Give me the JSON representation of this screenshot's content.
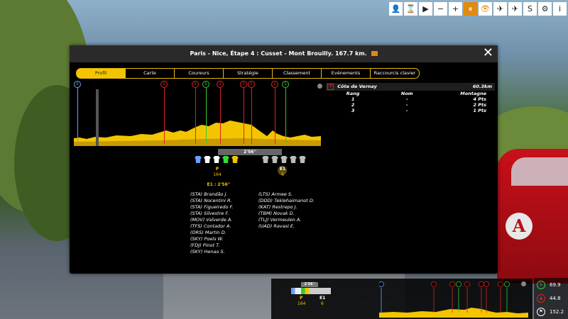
{
  "toolbar": {
    "buttons": [
      {
        "icon": "person-icon",
        "glyph": "👤"
      },
      {
        "icon": "hourglass-icon",
        "glyph": "⌛"
      },
      {
        "icon": "play-icon",
        "glyph": "▶"
      },
      {
        "icon": "minus-icon",
        "glyph": "−"
      },
      {
        "icon": "plus-icon",
        "glyph": "+"
      },
      {
        "icon": "pause-icon",
        "glyph": "⏸"
      },
      {
        "icon": "eye-icon",
        "glyph": "👁"
      },
      {
        "icon": "motorbike-icon",
        "glyph": "✈"
      },
      {
        "icon": "helicopter-icon",
        "glyph": "✈"
      },
      {
        "icon": "sprint-icon",
        "glyph": "S"
      },
      {
        "icon": "settings-icon",
        "glyph": "⚙"
      },
      {
        "icon": "info-icon",
        "glyph": "i"
      }
    ]
  },
  "window": {
    "title": "Paris - Nice, Étape 4 : Cusset - Mont Brouilly. 167.7 km.",
    "close_glyph": "✕"
  },
  "tabs": [
    "Profil",
    "Carte",
    "Coureurs",
    "Stratégie",
    "Classement",
    "Evénements",
    "Raccourcis clavier"
  ],
  "profile": {
    "markers": [
      {
        "label": "0",
        "type": "blue",
        "km_pct": 0.014
      },
      {
        "label": "3",
        "type": "red",
        "km_pct": 0.365
      },
      {
        "label": "3",
        "type": "red",
        "km_pct": 0.492
      },
      {
        "label": "S",
        "type": "green",
        "km_pct": 0.535
      },
      {
        "label": "3",
        "type": "red",
        "km_pct": 0.592
      },
      {
        "label": "3",
        "type": "red",
        "km_pct": 0.688
      },
      {
        "label": "3",
        "type": "red",
        "km_pct": 0.717
      },
      {
        "label": "2",
        "type": "red",
        "km_pct": 0.812
      },
      {
        "label": "S",
        "type": "green",
        "km_pct": 0.855
      }
    ],
    "current_pos_pct": 0.098
  },
  "groups": {
    "gap_label": "2'56''",
    "peloton": {
      "label": "P",
      "count": "164",
      "gap_text": "E1 : 2'56''"
    },
    "escape": {
      "label": "E1",
      "count": "6"
    },
    "peloton_jerseys": [
      "#6aa0ff",
      "#ffffff",
      "#ffffff",
      "#33dd33",
      "#f2c500"
    ],
    "escape_jerseys": [
      "#bbbbbb",
      "#bbbbbb",
      "#bbbbbb",
      "#bbbbbb",
      "#bbbbbb"
    ]
  },
  "riders_left": [
    "(STA) Brandão J.",
    "(STA) Nocentini R.",
    "(STA) Figueiredo F.",
    "(STA) Silvestre F.",
    "(MOV) Valverde A.",
    "(TFS) Contador A.",
    "(ORS) Martin D.",
    "(SKY) Poels W.",
    "(FDJ) Pinot T.",
    "(SKY) Henao S."
  ],
  "riders_right": [
    "(LTS) Armee S.",
    "(DDD) Teklehaimanot D.",
    "(KAT) Restrepo J.",
    "(TBM) Novak D.",
    "(TLJ) Vermeulen A.",
    "(UAD) Ravasi E."
  ],
  "climb": {
    "category": "3",
    "name": "Côte de Vernay",
    "distance": "60.3km",
    "headers": [
      "Rang",
      "Nom",
      "Montagne"
    ],
    "rows": [
      [
        "1",
        "-",
        "4 Pts"
      ],
      [
        "2",
        "-",
        "2 Pts"
      ],
      [
        "3",
        "-",
        "1 Pts"
      ]
    ]
  },
  "hud": {
    "gap_label": "2'56''",
    "peloton_label": "P",
    "peloton_count": "164",
    "escape_label": "E1",
    "escape_count": "6",
    "stats": [
      {
        "icon": "sprint-icon",
        "value": "69.9",
        "color": "#33cc33"
      },
      {
        "icon": "elevation-icon",
        "value": "44.8",
        "color": "#dd2222"
      },
      {
        "icon": "finish-flag-icon",
        "value": "152.2",
        "color": "#ffffff"
      }
    ]
  },
  "colors": {
    "accent": "#f2c500",
    "profile_fill": "#f2c500",
    "close": "#ffffff"
  }
}
